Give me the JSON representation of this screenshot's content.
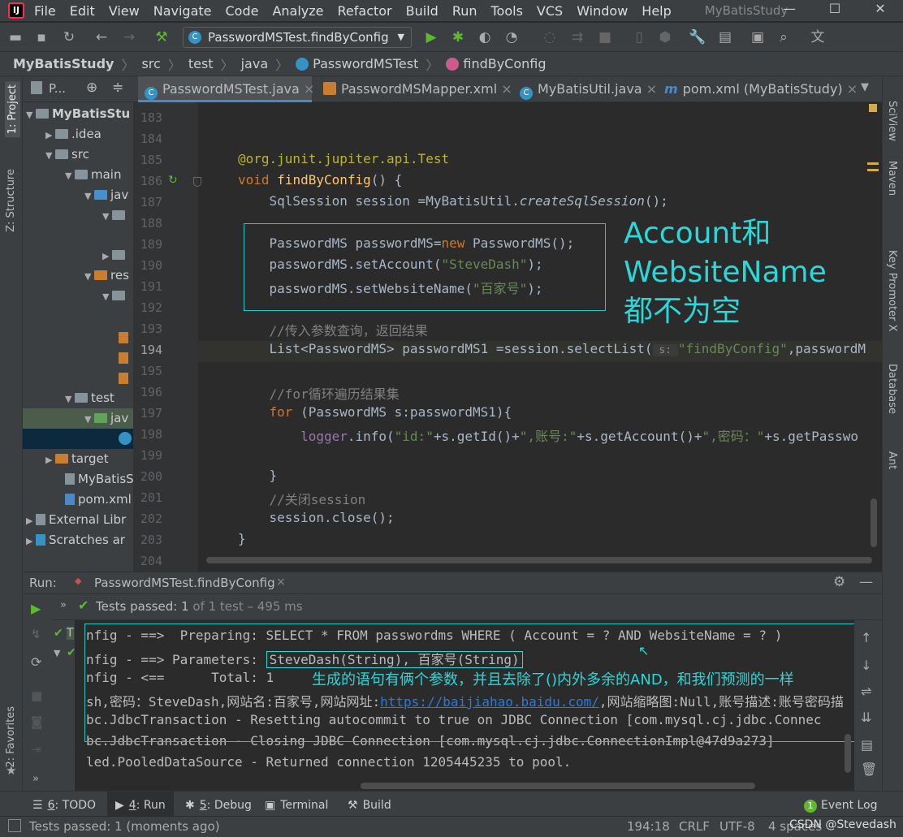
{
  "app": {
    "logo": "IJ",
    "project_title": "MyBatisStudy"
  },
  "menu": [
    "File",
    "Edit",
    "View",
    "Navigate",
    "Code",
    "Analyze",
    "Refactor",
    "Build",
    "Run",
    "Tools",
    "VCS",
    "Window",
    "Help"
  ],
  "window_buttons": {
    "minimize": "—",
    "maximize": "☐",
    "close": "✕"
  },
  "toolbar": {
    "run_config": "PasswordMSTest.findByConfig"
  },
  "breadcrumb": [
    "MyBatisStudy",
    "src",
    "test",
    "java",
    "PasswordMSTest",
    "findByConfig"
  ],
  "left_strip": {
    "project": "1: Project",
    "structure": "Z: Structure",
    "favorites": "2: Favorites"
  },
  "right_strip": [
    "SciView",
    "Maven",
    "Key Promoter X",
    "Database",
    "Ant"
  ],
  "project_panel": {
    "header": "P...",
    "items": [
      "MyBatisStu",
      ".idea",
      "src",
      "main",
      "jav",
      "",
      "",
      "res",
      "",
      "",
      "",
      "",
      "target",
      "MyBatisS",
      "pom.xml",
      "External Libr",
      "Scratches ar"
    ],
    "test": "test",
    "test_java": "jav"
  },
  "tabs": [
    {
      "label": "PasswordMSTest.java",
      "close": "×"
    },
    {
      "label": "PasswordMSMapper.xml",
      "close": "×"
    },
    {
      "label": "MyBatisUtil.java",
      "close": "×"
    },
    {
      "label": "pom.xml (MyBatisStudy)",
      "close": "×"
    }
  ],
  "line_numbers": [
    "183",
    "184",
    "185",
    "186",
    "187",
    "188",
    "189",
    "190",
    "191",
    "192",
    "193",
    "194",
    "195",
    "196",
    "197",
    "198",
    "199",
    "200",
    "201",
    "202",
    "203",
    "204"
  ],
  "code": {
    "l185": "@org.junit.jupiter.api.Test",
    "l186_kw": "void ",
    "l186_fn": "findByConfig",
    "l186_rest": "() {",
    "l187_a": "    SqlSession session =MyBatisUtil.",
    "l187_b": "createSqlSession",
    "l187_c": "();",
    "l189_a": "    PasswordMS passwordMS=",
    "l189_b": "new",
    "l189_c": " PasswordMS();",
    "l190_a": "    passwordMS.setAccount(",
    "l190_b": "\"SteveDash\"",
    "l190_c": ");",
    "l191_a": "    passwordMS.setWebsiteName(",
    "l191_b": "\"百家号\"",
    "l191_c": ");",
    "l193": "    //传入参数查询，返回结果",
    "l194_a": "    List<PasswordMS> passwordMS1 =session.selectList(",
    "l194_hint": " s: ",
    "l194_b": "\"findByConfig\"",
    "l194_c": ",passwordM",
    "l196": "    //for循环遍历结果集",
    "l197_a": "for",
    "l197_b": " (PasswordMS s:passwordMS1){",
    "l198_a": "        logger",
    "l198_b": ".info(",
    "l198_c": "\"id:\"",
    "l198_d": "+s.getId()+",
    "l198_e": "\",账号:\"",
    "l198_f": "+s.getAccount()+",
    "l198_g": "\",密码：\"",
    "l198_h": "+s.getPasswo",
    "l200": "    }",
    "l201": "    //关闭session",
    "l202": "    session.close();",
    "l203": "}"
  },
  "annotation_editor": {
    "line1": "Account和",
    "line2": "WebsiteName",
    "line3": "都不为空"
  },
  "run": {
    "label": "Run:",
    "tab": "PasswordMSTest.findByConfig",
    "tests_passed": "Tests passed:",
    "tests_count": "1",
    "tests_rest": "of 1 test – 495 ms",
    "tree_item": "T"
  },
  "console": [
    "nfig - ==>  Preparing: SELECT * FROM passwordms WHERE ( Account = ? AND WebsiteName = ? )",
    "nfig - ==> Parameters: ",
    "SteveDash(String), 百家号(String)",
    "nfig - <==      Total: 1",
    "sh,密码：SteveDash,网站名:百家号,网站网址:",
    "https://baijiahao.baidu.com/",
    ",网站缩略图:Null,账号描述:账号密码描",
    "bc.JdbcTransaction - Resetting autocommit to true on JDBC Connection [com.mysql.cj.jdbc.Connec",
    "bc.JdbcTransaction - Closing JDBC Connection [com.mysql.cj.jdbc.ConnectionImpl@47d9a273]",
    "led.PooledDataSource - Returned connection 1205445235 to pool."
  ],
  "annotation_console": "生成的语句有俩个参数，并且去除了()内外多余的AND，和我们预测的一样",
  "bottom_tabs": [
    {
      "num": "6",
      "label": ": TODO"
    },
    {
      "num": "4",
      "label": ": Run"
    },
    {
      "num": "5",
      "label": ": Debug"
    },
    {
      "num": "",
      "label": "Terminal"
    },
    {
      "num": "",
      "label": "Build"
    }
  ],
  "event_log": {
    "badge": "1",
    "label": "Event Log"
  },
  "status": {
    "message": "Tests passed: 1 (moments ago)",
    "position": "194:18",
    "line_sep": "CRLF",
    "encoding": "UTF-8",
    "indent": "4 spaces",
    "watermark": "CSDN @Stevedash"
  },
  "colors": {
    "accent": "#4a88c7",
    "annotation": "#29d9d9",
    "pass": "#5fb832"
  }
}
